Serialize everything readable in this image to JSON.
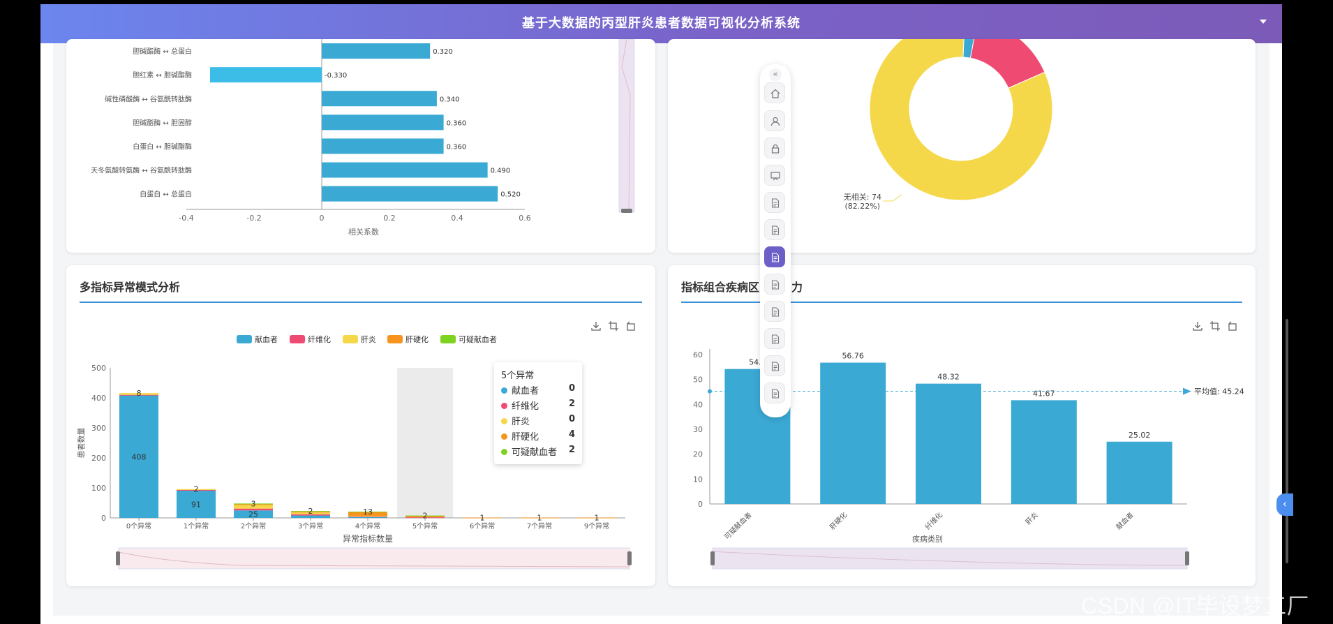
{
  "header": {
    "title": "基于大数据的丙型肝炎患者数据可视化分析系统"
  },
  "corr_chart": {
    "type": "bar",
    "orientation": "horizontal",
    "categories": [
      "胆碱酯酶 ↔ 总蛋白",
      "胆红素 ↔ 胆碱酯酶",
      "碱性磷酸酶 ↔ 谷氨酰转肽酶",
      "胆碱酯酶 ↔ 胆固醇",
      "白蛋白 ↔ 胆碱酯酶",
      "天冬氨酸转氨酶 ↔ 谷氨酰转肽酶",
      "白蛋白 ↔ 总蛋白"
    ],
    "values": [
      0.32,
      -0.33,
      0.34,
      0.36,
      0.36,
      0.49,
      0.52
    ],
    "value_labels": [
      "0.320",
      "-0.330",
      "0.340",
      "0.360",
      "0.360",
      "0.490",
      "0.520"
    ],
    "xticks": [
      "-0.4",
      "-0.2",
      "0",
      "0.2",
      "0.4",
      "0.6"
    ],
    "xlim": [
      -0.4,
      0.6
    ],
    "xlabel": "相关系数",
    "colors": {
      "positive": "#3aa9d4",
      "negative": "#3cbde8"
    }
  },
  "donut_chart": {
    "type": "pie",
    "label_line1": "无相关: 74",
    "label_line2": "(82.22%)",
    "slices": [
      {
        "value": 82.22,
        "color": "#f5d84a"
      },
      {
        "value": 15.5,
        "color": "#ee4a72"
      },
      {
        "value": 2.28,
        "color": "#3aa9d4"
      }
    ]
  },
  "abnormal_card": {
    "title": "多指标异常模式分析",
    "icons": [
      "download-icon",
      "crop-icon",
      "restore-icon"
    ]
  },
  "chart_data": [
    {
      "type": "bar",
      "stacked": true,
      "categories": [
        "0个异常",
        "1个异常",
        "2个异常",
        "3个异常",
        "4个异常",
        "5个异常",
        "6个异常",
        "7个异常",
        "9个异常"
      ],
      "series": [
        {
          "name": "献血者",
          "color": "#3aa9d4",
          "values": [
            408,
            91,
            25,
            8,
            3,
            0,
            0,
            0,
            0
          ]
        },
        {
          "name": "纤维化",
          "color": "#ee4a72",
          "values": [
            2,
            2,
            6,
            4,
            2,
            2,
            0,
            0,
            0
          ]
        },
        {
          "name": "肝炎",
          "color": "#f5d84a",
          "values": [
            6,
            3,
            12,
            6,
            2,
            0,
            0,
            0,
            0
          ]
        },
        {
          "name": "肝硬化",
          "color": "#f7941d",
          "values": [
            0,
            0,
            3,
            4,
            13,
            4,
            1,
            1,
            1
          ]
        },
        {
          "name": "可疑献血者",
          "color": "#7ed321",
          "values": [
            0,
            0,
            2,
            1,
            1,
            2,
            0,
            0,
            0
          ]
        }
      ],
      "data_labels": [
        "8",
        "408",
        "2",
        "91",
        "3",
        "25",
        "2",
        "13",
        "2",
        "1",
        "1",
        "1"
      ],
      "yticks": [
        "0",
        "100",
        "200",
        "300",
        "400",
        "500"
      ],
      "ylim": [
        0,
        500
      ],
      "xlabel": "异常指标数量",
      "ylabel": "患者数量",
      "legend": "top"
    },
    {
      "type": "bar",
      "categories": [
        "可疑献血者",
        "肝硬化",
        "纤维化",
        "肝炎",
        "献血者"
      ],
      "values": [
        54.2,
        56.76,
        48.32,
        41.67,
        25.02
      ],
      "value_labels": [
        "54.2",
        "56.76",
        "48.32",
        "41.67",
        "25.02"
      ],
      "yticks": [
        "0",
        "10",
        "20",
        "30",
        "40",
        "50",
        "60"
      ],
      "ylim": [
        0,
        60
      ],
      "xlabel": "疾病类别",
      "mean_line": {
        "value": 45.24,
        "label": "平均值: 45.24"
      },
      "color": "#3aa9d4"
    }
  ],
  "tooltip": {
    "title": "5个异常",
    "rows": [
      {
        "name": "献血者",
        "value": "0",
        "color": "#3aa9d4"
      },
      {
        "name": "纤维化",
        "value": "2",
        "color": "#ee4a72"
      },
      {
        "name": "肝炎",
        "value": "0",
        "color": "#f5d84a"
      },
      {
        "name": "肝硬化",
        "value": "4",
        "color": "#f7941d"
      },
      {
        "name": "可疑献血者",
        "value": "2",
        "color": "#7ed321"
      }
    ]
  },
  "combo_card": {
    "title": "指标组合疾病区",
    "title_tail": "力"
  },
  "sidebar": {
    "collapse_glyph": "«",
    "icons": [
      "home-icon",
      "user-icon",
      "lock-icon",
      "presentation-icon",
      "document-icon",
      "document-icon",
      "document-icon",
      "document-icon",
      "document-icon",
      "document-icon",
      "document-icon",
      "document-icon"
    ],
    "active_index": 6
  },
  "watermark": "CSDN @IT毕设梦工厂"
}
